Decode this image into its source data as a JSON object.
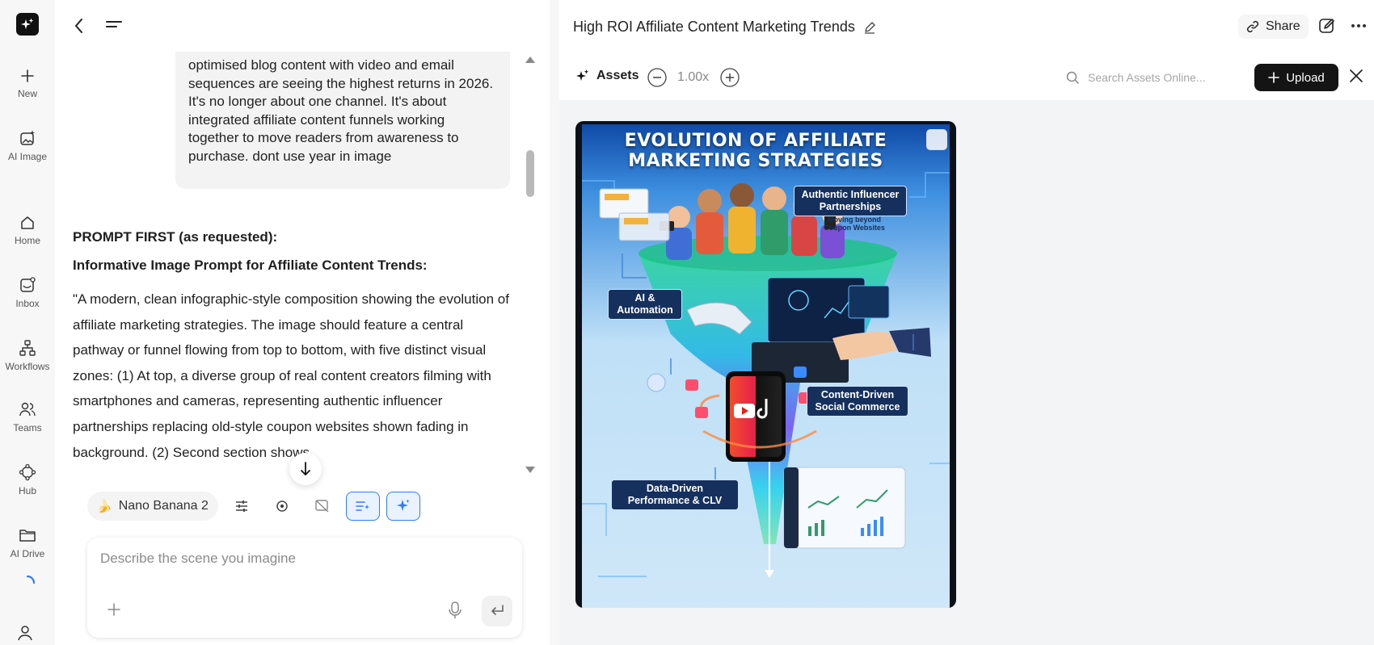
{
  "rail": {
    "items": [
      {
        "label": "New"
      },
      {
        "label": "AI Image"
      },
      {
        "label": "Home"
      },
      {
        "label": "Inbox"
      },
      {
        "label": "Workflows"
      },
      {
        "label": "Teams"
      },
      {
        "label": "Hub"
      },
      {
        "label": "AI Drive"
      }
    ]
  },
  "chat": {
    "user_message": "optimised blog content with video and email sequences are seeing the highest returns in 2026. It's no longer about one channel. It's about integrated affiliate content funnels working together to move readers from awareness to purchase. dont use year in image",
    "response_heading": "PROMPT FIRST (as requested):",
    "response_subheading": "Informative Image Prompt for Affiliate Content Trends:",
    "response_body": "\"A modern, clean infographic-style composition showing the evolution of affiliate marketing strategies. The image should feature a central pathway or funnel flowing from top to bottom, with five distinct visual zones: (1) At top, a diverse group of real content creators filming with smartphones and cameras, representing authentic influencer partnerships replacing old-style coupon websites shown fading in background. (2) Second section shows"
  },
  "toolbar": {
    "model_label": "Nano Banana 2"
  },
  "composer": {
    "placeholder": "Describe the scene you imagine"
  },
  "header": {
    "title": "High ROI Affiliate Content Marketing Trends",
    "share_label": "Share"
  },
  "assets": {
    "title": "Assets",
    "zoom": "1.00x",
    "search_placeholder": "Search Assets Online...",
    "upload_label": "Upload"
  },
  "infographic": {
    "title_line1": "EVOLUTION OF AFFILIATE",
    "title_line2": "MARKETING STRATEGIES",
    "labels": {
      "influencer": "Authentic Influencer Partnerships",
      "influencer_sub": "Moving beyond Coupon Websites",
      "ai": "AI & Automation",
      "social": "Content-Driven Social Commerce",
      "data": "Data-Driven Performance & CLV"
    }
  },
  "colors": {
    "accent": "#2f7cf6",
    "upload_bg": "#141414"
  }
}
